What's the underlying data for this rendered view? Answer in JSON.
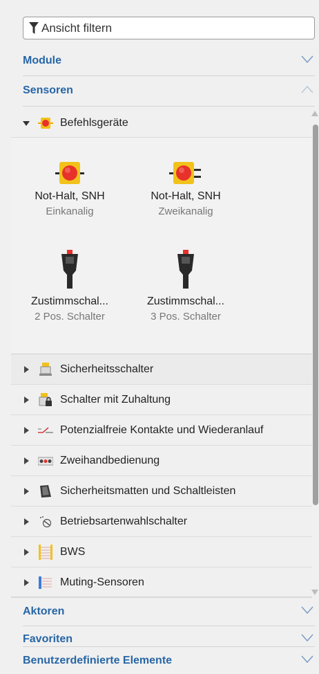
{
  "filter": {
    "placeholder": "Ansicht filtern"
  },
  "sections": {
    "module": "Module",
    "sensoren": "Sensoren",
    "aktoren": "Aktoren",
    "favoriten": "Favoriten",
    "benutzer": "Benutzerdefinierte Elemente"
  },
  "befehlsgeraete": {
    "label": "Befehlsgeräte",
    "tiles": [
      {
        "title": "Not-Halt, SNH",
        "subtitle": "Einkanalig"
      },
      {
        "title": "Not-Halt, SNH",
        "subtitle": "Zweikanalig"
      },
      {
        "title": "Zustimmschal...",
        "subtitle": "2 Pos. Schalter"
      },
      {
        "title": "Zustimmschal...",
        "subtitle": "3 Pos. Schalter"
      }
    ]
  },
  "categories": [
    {
      "label": "Sicherheitsschalter",
      "icon": "safety-switch-icon"
    },
    {
      "label": "Schalter mit Zuhaltung",
      "icon": "locking-switch-icon"
    },
    {
      "label": "Potenzialfreie Kontakte und Wiederanlauf",
      "icon": "contact-icon"
    },
    {
      "label": "Zweihandbedienung",
      "icon": "two-hand-icon"
    },
    {
      "label": "Sicherheitsmatten und Schaltleisten",
      "icon": "safety-mat-icon"
    },
    {
      "label": "Betriebsartenwahlschalter",
      "icon": "mode-selector-icon"
    },
    {
      "label": "BWS",
      "icon": "light-curtain-icon"
    },
    {
      "label": "Muting-Sensoren",
      "icon": "muting-sensor-icon"
    }
  ],
  "colors": {
    "accent": "#2766a6",
    "estop_red": "#e8312a",
    "estop_yellow": "#f2c21b"
  }
}
